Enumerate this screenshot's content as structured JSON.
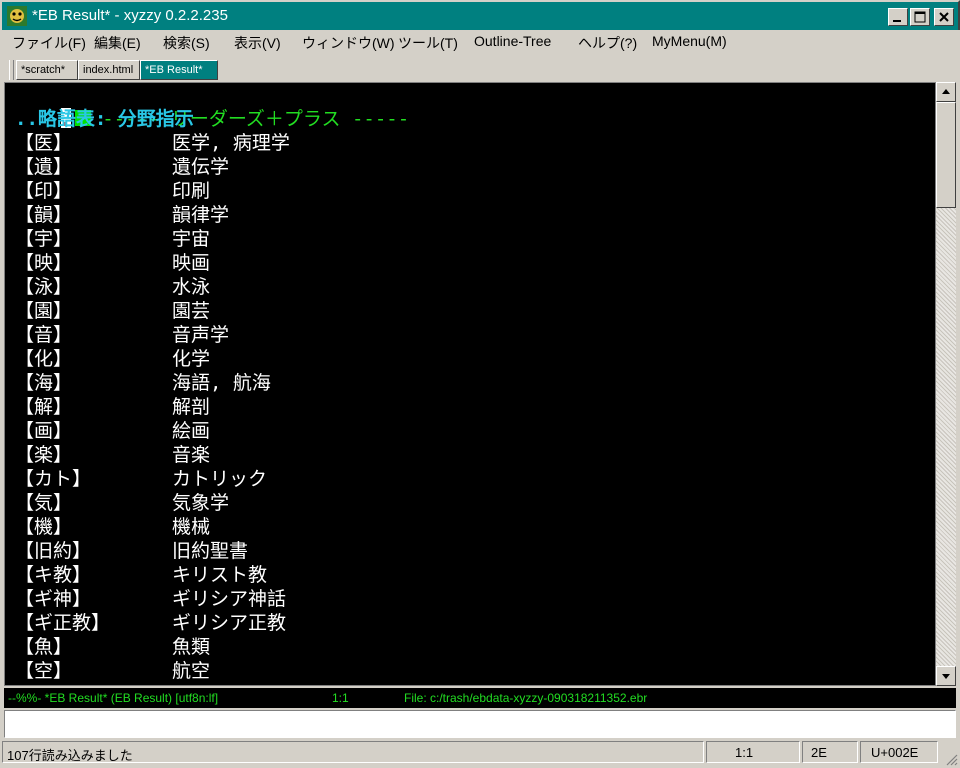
{
  "window": {
    "title": "*EB Result* - xyzzy 0.2.2.235",
    "icon": "xyzzy-app-icon"
  },
  "menu": {
    "items": [
      "ファイル(F)",
      "編集(E)",
      "検索(S)",
      "表示(V)",
      "ウィンドウ(W)",
      "ツール(T)",
      "Outline-Tree",
      "ヘルプ(?)",
      "MyMenu(M)"
    ]
  },
  "tabs": [
    {
      "label": "*scratch*",
      "active": false
    },
    {
      "label": "index.html",
      "active": false
    },
    {
      "label": "*EB Result*",
      "active": true
    }
  ],
  "editor": {
    "header": "----- リーダーズ＋プラス -----",
    "subheader": "..略語表: 分野指示",
    "rows": [
      {
        "abbr": "【医】",
        "meaning": "医学, 病理学"
      },
      {
        "abbr": "【遺】",
        "meaning": "遺伝学"
      },
      {
        "abbr": "【印】",
        "meaning": "印刷"
      },
      {
        "abbr": "【韻】",
        "meaning": "韻律学"
      },
      {
        "abbr": "【宇】",
        "meaning": "宇宙"
      },
      {
        "abbr": "【映】",
        "meaning": "映画"
      },
      {
        "abbr": "【泳】",
        "meaning": "水泳"
      },
      {
        "abbr": "【園】",
        "meaning": "園芸"
      },
      {
        "abbr": "【音】",
        "meaning": "音声学"
      },
      {
        "abbr": "【化】",
        "meaning": "化学"
      },
      {
        "abbr": "【海】",
        "meaning": "海語, 航海"
      },
      {
        "abbr": "【解】",
        "meaning": "解剖"
      },
      {
        "abbr": "【画】",
        "meaning": "絵画"
      },
      {
        "abbr": "【楽】",
        "meaning": "音楽"
      },
      {
        "abbr": "【カト】",
        "meaning": "カトリック"
      },
      {
        "abbr": "【気】",
        "meaning": "気象学"
      },
      {
        "abbr": "【機】",
        "meaning": "機械"
      },
      {
        "abbr": "【旧約】",
        "meaning": "旧約聖書"
      },
      {
        "abbr": "【キ教】",
        "meaning": "キリスト教"
      },
      {
        "abbr": "【ギ神】",
        "meaning": "ギリシア神話"
      },
      {
        "abbr": "【ギ正教】",
        "meaning": "ギリシア正教"
      },
      {
        "abbr": "【魚】",
        "meaning": "魚類"
      },
      {
        "abbr": "【空】",
        "meaning": "航空"
      }
    ]
  },
  "modeline": {
    "status": "--%%- *EB Result* (EB Result) [utf8n:lf]",
    "position": "1:1",
    "file": "File: c:/trash/ebdata-xyzzy-090318211352.ebr"
  },
  "minibuffer": {
    "value": ""
  },
  "statusbar": {
    "message": "107行読み込みました",
    "position": "1:1",
    "char_hex": "2E",
    "codepoint": "U+002E"
  },
  "colors": {
    "titlebar": "#008080",
    "editor_bg": "#000000",
    "header_green": "#22dd22",
    "subheader_cyan": "#29c7e6",
    "text": "#ffffff"
  }
}
